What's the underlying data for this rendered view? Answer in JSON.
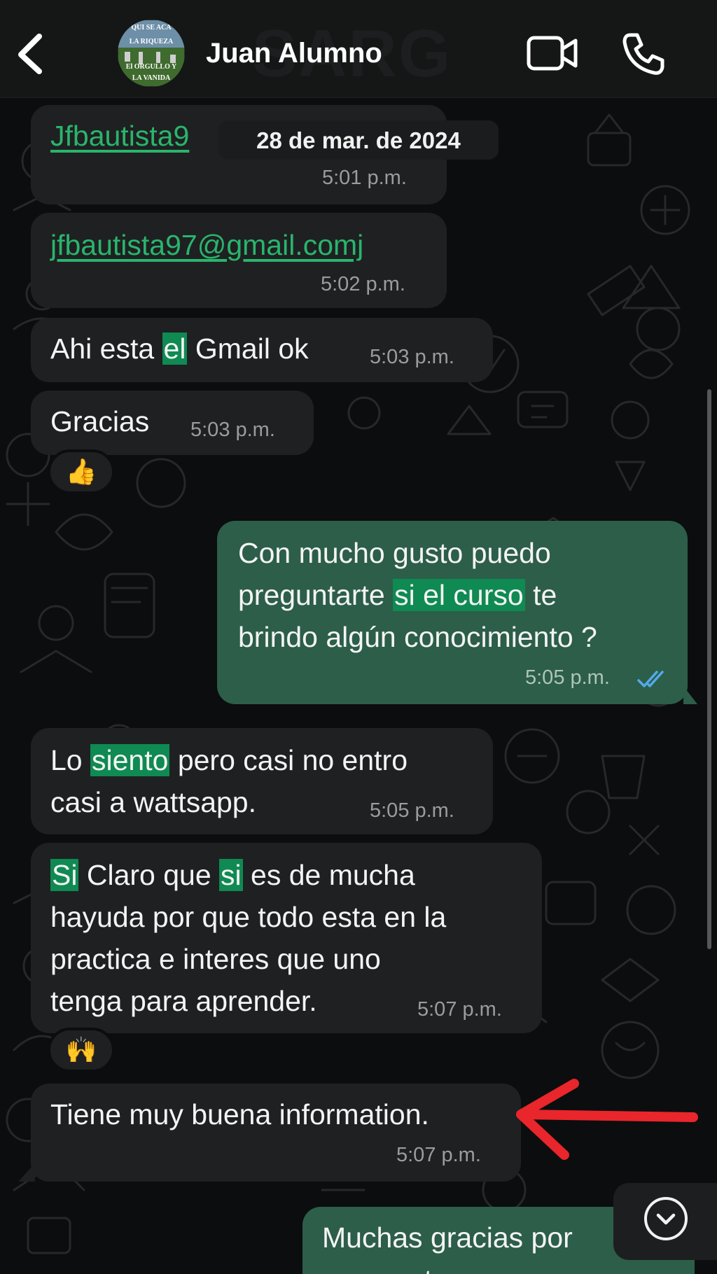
{
  "header": {
    "contact_name": "Juan Alumno",
    "watermark": "SARG",
    "avatar_lines": [
      "QUI SE ACA",
      "LA RIQUEZA",
      "El ORGULLO Y",
      "LA VANIDA"
    ],
    "icons": {
      "back": "chevron-left-icon",
      "video": "video-camera-icon",
      "call": "phone-icon"
    }
  },
  "date_separator": "28 de mar. de 2024",
  "messages": [
    {
      "dir": "in",
      "text": "Jfbautista9",
      "time": "5:01 p.m."
    },
    {
      "dir": "in",
      "text": "jfbautista97@gmail.comj",
      "time": "5:02 p.m."
    },
    {
      "dir": "in",
      "parts": [
        "Ahi esta ",
        "el",
        " Gmail ok"
      ],
      "time": "5:03 p.m."
    },
    {
      "dir": "in",
      "text": "Gracias",
      "time": "5:03 p.m.",
      "reaction": "👍"
    },
    {
      "dir": "out",
      "lines": [
        "Con mucho gusto puedo",
        "preguntarte ",
        "si el curso",
        " te",
        "brindo algún conocimiento ?"
      ],
      "time": "5:05 p.m.",
      "status": "read"
    },
    {
      "dir": "in",
      "lines": [
        "Lo ",
        "siento",
        " pero casi no entro",
        "casi a wattsapp."
      ],
      "time": "5:05 p.m."
    },
    {
      "dir": "in",
      "lines": [
        "Si",
        " Claro que ",
        "si",
        " es de mucha",
        "hayuda por que todo esta en la",
        "practica e interes que uno",
        "tenga para aprender."
      ],
      "time": "5:07 p.m.",
      "reaction": "🙌"
    },
    {
      "dir": "in",
      "text": "Tiene muy buena information.",
      "time": "5:07 p.m."
    },
    {
      "dir": "out",
      "text": "Muchas gracias por",
      "text2": "respuesta"
    }
  ],
  "colors": {
    "background": "#0c0d0e",
    "incoming_bubble": "#1f2022",
    "outgoing_bubble": "#2c5e49",
    "highlight": "#0f8a52",
    "link": "#29b56c",
    "annotation_arrow": "#e8262b",
    "read_ticks": "#53a9ea"
  }
}
